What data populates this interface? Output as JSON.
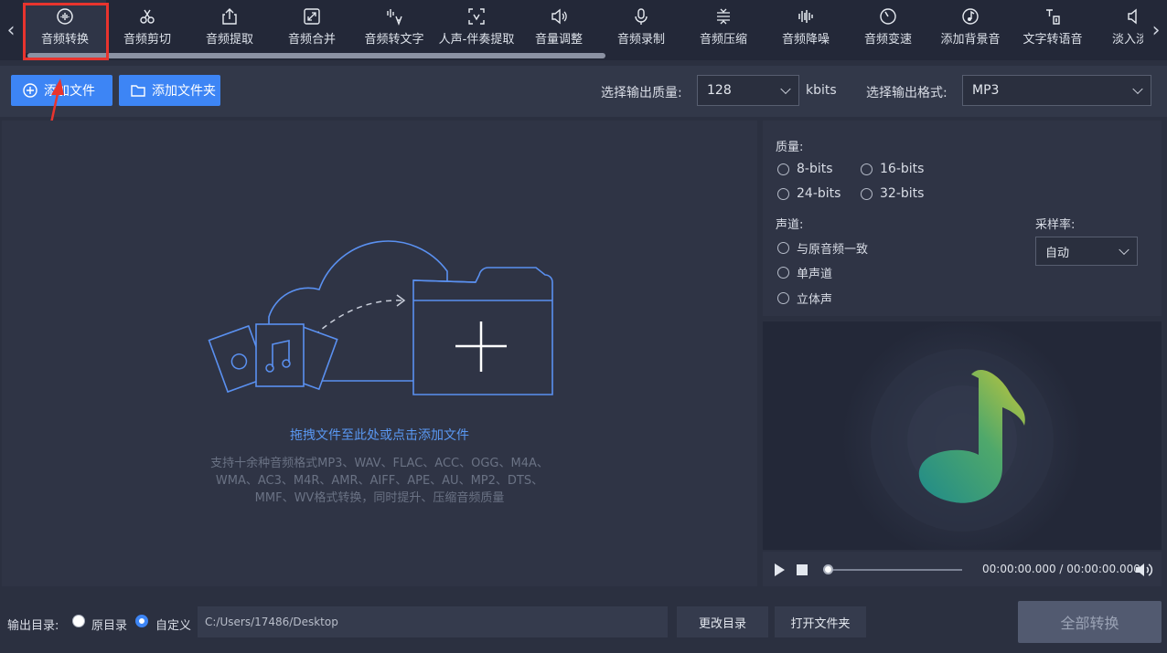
{
  "toolbar": {
    "tools": [
      {
        "label": "音频转换",
        "icon": "waveform-circle-icon",
        "active": true
      },
      {
        "label": "音频剪切",
        "icon": "scissors-icon"
      },
      {
        "label": "音频提取",
        "icon": "export-icon"
      },
      {
        "label": "音频合并",
        "icon": "merge-icon"
      },
      {
        "label": "音频转文字",
        "icon": "audio-to-text-icon"
      },
      {
        "label": "人声-伴奏提取",
        "icon": "voice-extract-icon"
      },
      {
        "label": "音量调整",
        "icon": "volume-icon"
      },
      {
        "label": "音频录制",
        "icon": "microphone-icon"
      },
      {
        "label": "音频压缩",
        "icon": "compress-icon"
      },
      {
        "label": "音频降噪",
        "icon": "denoise-icon"
      },
      {
        "label": "音频变速",
        "icon": "speed-icon"
      },
      {
        "label": "添加背景音",
        "icon": "background-music-icon"
      },
      {
        "label": "文字转语音",
        "icon": "text-to-speech-icon"
      },
      {
        "label": "淡入淡",
        "icon": "fade-icon"
      }
    ]
  },
  "actions": {
    "add_file": "添加文件",
    "add_folder": "添加文件夹",
    "quality_label": "选择输出质量:",
    "quality_value": "128",
    "quality_unit": "kbits",
    "format_label": "选择输出格式:",
    "format_value": "MP3"
  },
  "drop": {
    "hint": "拖拽文件至此处或点击添加文件",
    "formats_lines": [
      "支持十余种音频格式MP3、WAV、FLAC、ACC、OGG、M4A、",
      "WMA、AC3、M4R、AMR、AIFF、APE、AU、MP2、DTS、",
      "MMF、WV格式转换，同时提升、压缩音频质量"
    ]
  },
  "settings": {
    "quality_label": "质量:",
    "quality_options": [
      "8-bits",
      "16-bits",
      "24-bits",
      "32-bits"
    ],
    "channel_label": "声道:",
    "channel_options": [
      "与原音频一致",
      "单声道",
      "立体声"
    ],
    "sample_rate_label": "采样率:",
    "sample_rate_value": "自动"
  },
  "player": {
    "time": "00:00:00.000 / 00:00:00.000",
    "progress": 0
  },
  "bottom": {
    "output_dir_label": "输出目录:",
    "original_dir": "原目录",
    "custom_dir": "自定义",
    "path": "C:/Users/17486/Desktop",
    "change_dir": "更改目录",
    "open_folder": "打开文件夹",
    "convert_all": "全部转换"
  },
  "colors": {
    "accent": "#3d85f5",
    "highlight_box": "#e8342e",
    "background": "#2b3040"
  }
}
